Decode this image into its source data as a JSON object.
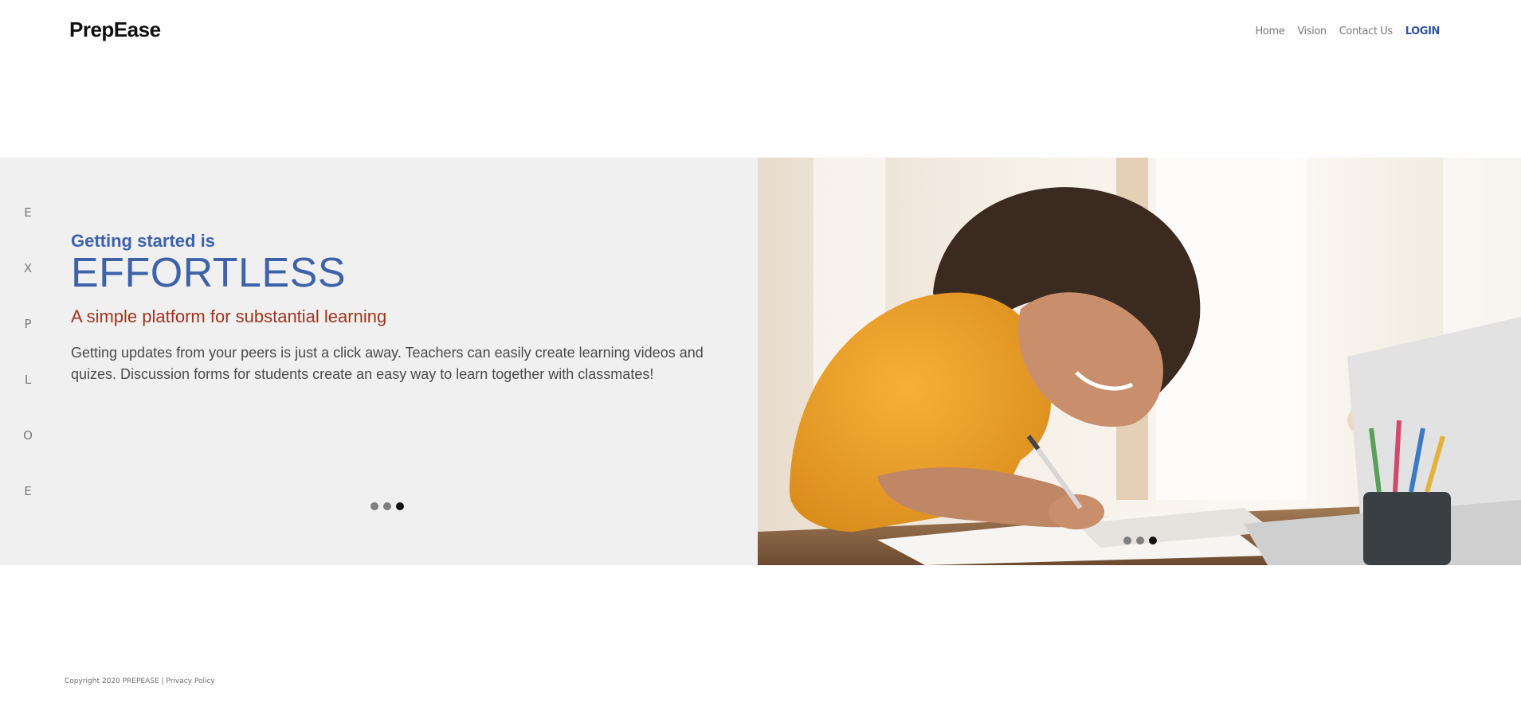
{
  "brand": {
    "name": "PrepEase"
  },
  "nav": {
    "home": "Home",
    "vision": "Vision",
    "contact": "Contact Us",
    "login": "LOGIN"
  },
  "hero": {
    "side_letters": [
      "E",
      "X",
      "P",
      "L",
      "O",
      "E"
    ],
    "small_heading": "Getting started is",
    "big_heading": "EFFORTLESS",
    "tagline": "A simple platform for substantial learning",
    "description": "Getting updates from your peers is just a click away. Teachers can easily create learning videos and quizes. Discussion forms for students create an easy way to learn together with classmates!",
    "text_slider": {
      "slide_count": 3,
      "active_index": 2
    },
    "image_slider": {
      "slide_count": 3,
      "active_index": 2
    }
  },
  "footer": {
    "copyright": "Copyright 2020 PREPEASE |",
    "privacy": "Privacy Policy"
  },
  "colors": {
    "accent_blue": "#3e62aa",
    "tagline_red": "#a1341e",
    "hero_bg": "#f0f0f0"
  },
  "icons": {
    "hero_photo": "student-writing-photo"
  }
}
